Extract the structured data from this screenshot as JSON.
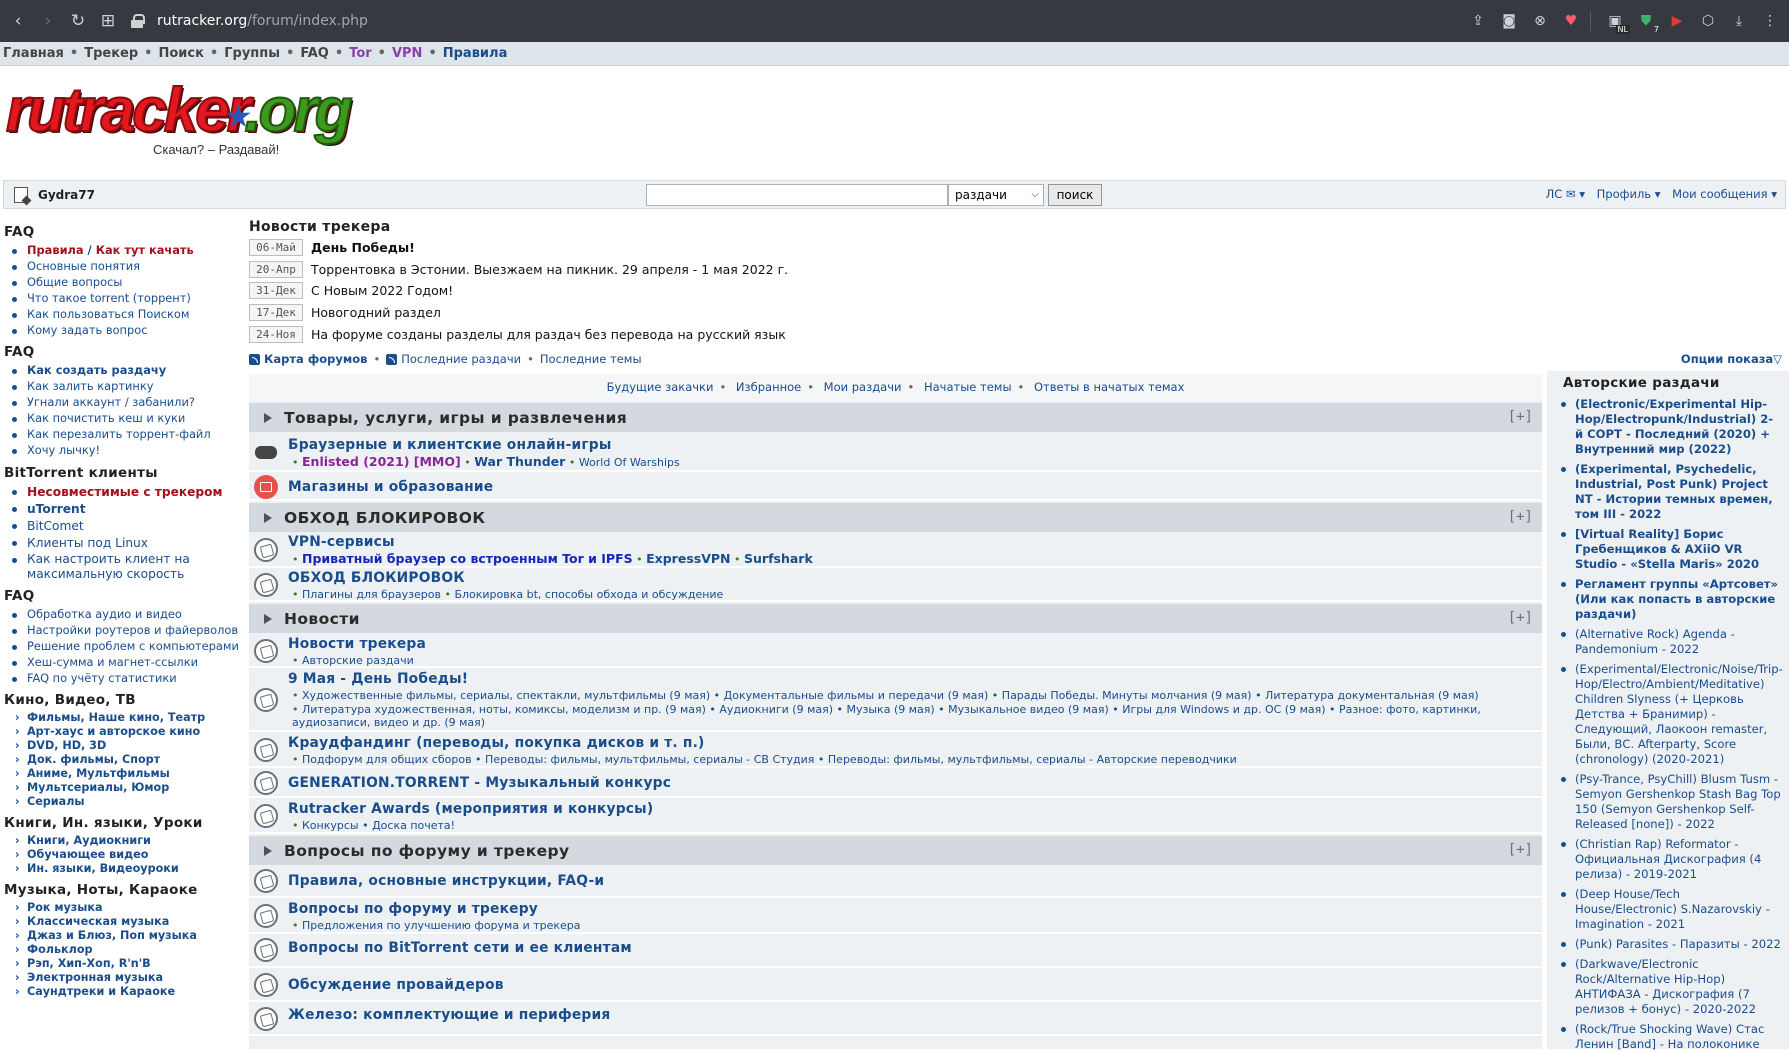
{
  "browser": {
    "url_domain": "rutracker.org",
    "url_path": "/forum/index.php",
    "ext_badge_nl": "NL",
    "ext_badge_count": "7"
  },
  "topnav": {
    "items": [
      "Главная",
      "Трекер",
      "Поиск",
      "Группы",
      "FAQ",
      "Tor",
      "VPN",
      "Правила"
    ]
  },
  "logo": {
    "text": "rutracker",
    "tld": ".org",
    "slogan": "Скачал? – Раздавай!"
  },
  "userbar": {
    "username": "Gydra77",
    "search_scope": "раздачи",
    "search_button": "поиск",
    "links": [
      "ЛС ✉ ▾",
      "Профиль ▾",
      "Мои сообщения ▾"
    ]
  },
  "left": {
    "faq1": {
      "title": "FAQ",
      "rules": "Правила",
      "slash": " / ",
      "howto": "Как тут качать",
      "items": [
        "Основные понятия",
        "Общие вопросы",
        "Что такое torrent (торрент)",
        "Как пользоваться Поиском",
        "Кому задать вопрос"
      ]
    },
    "faq2": {
      "title": "FAQ",
      "items": [
        "Как создать раздачу",
        "Как залить картинку",
        "Угнали аккаунт / забанили?",
        "Как почистить кеш и куки",
        "Как перезалить торрент-файл",
        "Хочу лычку!"
      ]
    },
    "bt": {
      "title": "BitTorrent клиенты",
      "incompat": "Несовместимые с трекером",
      "utorrent": "uTorrent",
      "items": [
        "BitComet",
        "Клиенты под Linux",
        "Как настроить клиент на максимальную скорость"
      ]
    },
    "faq3": {
      "title": "FAQ",
      "items": [
        "Обработка аудио и видео",
        "Настройки роутеров и файерволов",
        "Решение проблем с компьютерами",
        "Хеш-сумма и магнет-ссылки",
        "FAQ по учёту статистики"
      ]
    },
    "kino": {
      "title": "Кино, Видео, ТВ",
      "items": [
        "Фильмы, Наше кино, Театр",
        "Арт-хаус и авторское кино",
        "DVD, HD, 3D",
        "Док. фильмы, Спорт",
        "Аниме, Мультфильмы",
        "Мультсериалы, Юмор",
        "Сериалы"
      ]
    },
    "books": {
      "title": "Книги, Ин. языки, Уроки",
      "items": [
        "Книги, Аудиокниги",
        "Обучающее видео",
        "Ин. языки, Видеоуроки"
      ]
    },
    "music": {
      "title": "Музыка, Ноты, Караоке",
      "items": [
        "Рок музыка",
        "Классическая музыка",
        "Джаз и Блюз, Поп музыка",
        "Фольклор",
        "Рэп, Хип-Хоп, R'n'B",
        "Электронная музыка",
        "Саундтреки и Караоке"
      ]
    }
  },
  "news": {
    "title": "Новости трекера",
    "items": [
      {
        "date": "06-Май",
        "text": "День Победы!"
      },
      {
        "date": "20-Апр",
        "text": "Торрентовка в Эстонии. Выезжаем на пикник. 29 апреля - 1 мая 2022 г."
      },
      {
        "date": "31-Дек",
        "text": "С Новым 2022 Годом!"
      },
      {
        "date": "17-Дек",
        "text": "Новогодний раздел"
      },
      {
        "date": "24-Ноя",
        "text": "На форуме созданы разделы для раздач без перевода на русский язык"
      }
    ]
  },
  "feeds": {
    "map": "Карта форумов",
    "recent": "Последние раздачи",
    "topics": "Последние темы",
    "options": "Опции показа▽"
  },
  "quick": [
    "Будущие закачки",
    "Избранное",
    "Мои раздачи",
    "Начатые темы",
    "Ответы в начатых темах"
  ],
  "forum": {
    "plus": "[+]",
    "cat1": {
      "title": "Товары, услуги, игры и развлечения",
      "f1": {
        "title": "Браузерные и клиентские онлайн-игры",
        "s1": "Enlisted (2021) [MMO]",
        "s2": "War Thunder",
        "s3": "World Of Warships"
      },
      "f2": {
        "title": "Магазины и образование"
      }
    },
    "cat2": {
      "title": "ОБХОД БЛОКИРОВОК",
      "f1": {
        "title": "VPN-сервисы",
        "s1": "Приватный браузер со встроенным Tor и IPFS",
        "s2": "ExpressVPN",
        "s3": "Surfshark"
      },
      "f2": {
        "title": "ОБХОД БЛОКИРОВОК",
        "s1": "Плагины для браузеров",
        "s2": "Блокировка bt, способы обхода и обсуждение"
      }
    },
    "cat3": {
      "title": "Новости",
      "f1": {
        "title": "Новости трекера",
        "s1": "Авторские раздачи"
      },
      "f2": {
        "title": "9 Мая - День Победы!",
        "line1": "Художественные фильмы, сериалы, спектакли, мультфильмы (9 мая) • Документальные фильмы и передачи (9 мая) • Парады Победы. Минуты молчания (9 мая) • Литература документальная (9 мая)",
        "line2": "Литература художественная, ноты, комиксы, моделизм и пр. (9 мая) • Аудиокниги (9 мая) • Музыка (9 мая) • Музыкальное видео (9 мая) • Игры для Windows и др. ОС (9 мая) • Разное: фото, картинки,",
        "line3": "аудиозаписи, видео и др. (9 мая)"
      },
      "f3": {
        "title": "Краудфандинг (переводы, покупка дисков и т. п.)",
        "s1": "Подфорум для общих сборов • Переводы: фильмы, мультфильмы, сериалы - СВ Студия • Переводы: фильмы, мультфильмы, сериалы - Авторские переводчики"
      },
      "f4": {
        "title": "GENERATION.TORRENT - Музыкальный конкурс"
      },
      "f5": {
        "title": "Rutracker Awards (мероприятия и конкурсы)",
        "s1": "Конкурсы • Доска почета!"
      }
    },
    "cat4": {
      "title": "Вопросы по форуму и трекеру",
      "f1": {
        "title": "Правила, основные инструкции, FAQ-и"
      },
      "f2": {
        "title": "Вопросы по форуму и трекеру",
        "s1": "Предложения по улучшению форума и трекера"
      },
      "f3": {
        "title": "Вопросы по BitTorrent сети и ее клиентам"
      },
      "f4": {
        "title": "Обсуждение провайдеров"
      },
      "f5": {
        "title": "Железо: комплектующие и периферия"
      }
    }
  },
  "right": {
    "title": "Авторские раздачи",
    "items": [
      {
        "text": "(Electronic/Experimental Hip-Hop/Electropunk/Industrial) 2-й СОРТ - Последний (2020) + Внутренний мир (2022)",
        "bold": true
      },
      {
        "text": "(Experimental, Psychedelic, Industrial, Post Punk) Project NT - Истории темных времен, том III - 2022",
        "bold": true
      },
      {
        "text": "[Virtual Reality] Борис Гребенщиков & AXiiO VR Studio - «Stella Maris» 2020",
        "bold": true
      },
      {
        "text": "Регламент группы «Артсовет» (Или как попасть в авторские раздачи)",
        "bold": true
      },
      {
        "text": "(Alternative Rock) Agenda - Pandemonium - 2022",
        "bold": false
      },
      {
        "text": "(Experimental/Electronic/Noise/Trip-Hop/Electro/Ambient/Meditative) Children Slyness (+ Церковь Детства + Бранимир) - Следующий, Лаокоон remaster, Были, ВС. Afterparty, Score (chronology) (2020-2021)",
        "bold": false
      },
      {
        "text": "(Psy-Trance, PsyChill) Blusm Tusm - Semyon Gershenkop Stash Bag Top 150 (Semyon Gershenkop Self-Released [none]) - 2022",
        "bold": false
      },
      {
        "text": "(Christian Rap) Reformator - Официальная Дискография (4 релиза) - 2019-2021",
        "bold": false
      },
      {
        "text": "(Deep House/Tech House/Electronic) S.Nazarovskiy - Imagination - 2021",
        "bold": false
      },
      {
        "text": "(Punk) Parasites - Паразиты - 2022",
        "bold": false
      },
      {
        "text": "(Darkwave/Electronic Rock/Alternative Hip-Hop) АНТИФАЗА - Дискография (7 релизов + бонус) - 2020-2022",
        "bold": false
      },
      {
        "text": "(Rock/True Shocking Wave) Стас Ленин [Band] - На полоконике",
        "bold": false
      }
    ]
  }
}
